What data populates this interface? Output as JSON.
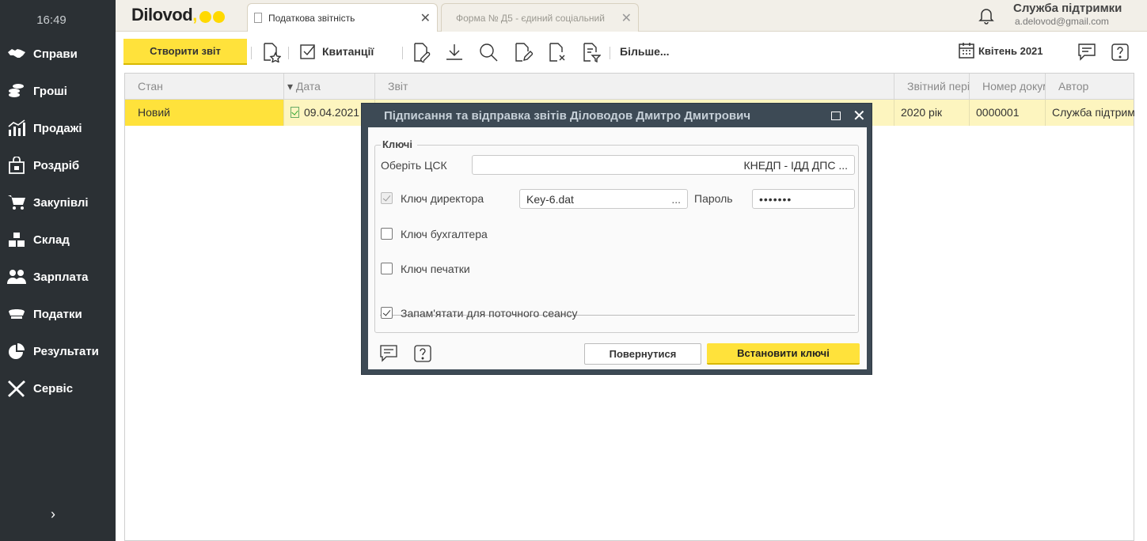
{
  "sidebar": {
    "clock": "16:49",
    "items": [
      {
        "label": "Справи",
        "icon": "handshake-icon"
      },
      {
        "label": "Гроші",
        "icon": "coins-icon"
      },
      {
        "label": "Продажі",
        "icon": "sales-chart-icon"
      },
      {
        "label": "Роздріб",
        "icon": "shopping-bag-icon"
      },
      {
        "label": "Закупівлі",
        "icon": "cart-icon"
      },
      {
        "label": "Склад",
        "icon": "boxes-icon"
      },
      {
        "label": "Зарплата",
        "icon": "people-icon"
      },
      {
        "label": "Податки",
        "icon": "officer-cap-icon"
      },
      {
        "label": "Результати",
        "icon": "pie-chart-icon"
      },
      {
        "label": "Сервіс",
        "icon": "tools-icon"
      }
    ],
    "expander": "›"
  },
  "topbar": {
    "logo_text": "Dilovod",
    "tabs": [
      {
        "label": "Податкова звітність",
        "active": true
      },
      {
        "label": "Форма № Д5 - єдиний соціальний",
        "active": false
      }
    ],
    "close_glyph": "✕",
    "user_name": "Служба підтримки",
    "user_email": "a.delovod@gmail.com"
  },
  "toolbar": {
    "create_label": "Створити звіт",
    "receipts_label": "Квитанції",
    "more_label": "Більше...",
    "period_label": "Квітень 2021"
  },
  "grid": {
    "columns": [
      "Стан",
      "Дата",
      "Звіт",
      "Звітний період",
      "Номер документа",
      "Автор"
    ],
    "sort_glyph": "▾",
    "rows": [
      {
        "state": "Новий",
        "date": "09.04.2021",
        "report": "",
        "period": "2020 рік",
        "number": "0000001",
        "author": "Служба підтримки"
      }
    ]
  },
  "modal": {
    "title": "Підписання та відправка звітів Діловодов Дмитро Дмитрович",
    "close_glyph": "✕",
    "group_label": "Ключі",
    "csk_label": "Оберіть ЦСК",
    "csk_value": "КНЕДП - ІДД ДПС ...",
    "director_label": "Ключ директора",
    "director_file": "Key-6.dat",
    "browse_glyph": "...",
    "password_label": "Пароль",
    "password_value": "•••••••",
    "accountant_label": "Ключ бухгалтера",
    "seal_label": "Ключ печатки",
    "remember_label": "Запам'ятати для поточного сеансу",
    "back_label": "Повернутися",
    "set_label": "Встановити ключі",
    "help_glyph": "?"
  },
  "colors": {
    "accent_yellow": "#ffe23b",
    "sidebar_bg": "#2b3034",
    "modal_header": "#3d4a55",
    "row_highlight": "#fdf5bf"
  }
}
